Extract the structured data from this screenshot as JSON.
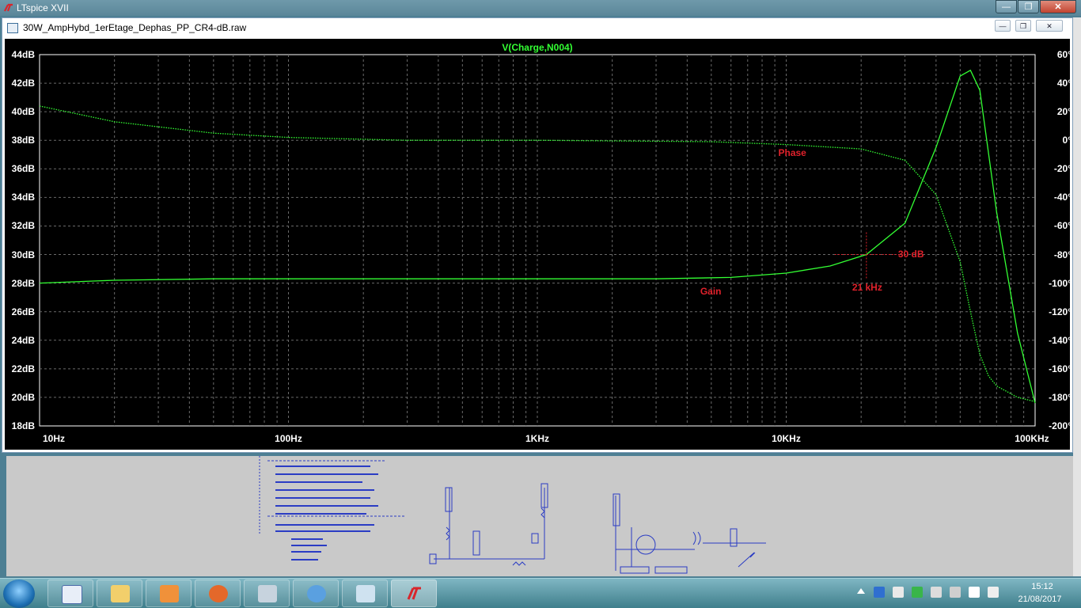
{
  "app": {
    "title": "LTspice XVII"
  },
  "child_window": {
    "title": "30W_AmpHybd_1erEtage_Dephas_PP_CR4-dB.raw"
  },
  "window_buttons": {
    "minimize": "—",
    "maximize": "❐",
    "close": "✕"
  },
  "child_buttons": {
    "minimize": "—",
    "restore": "❐",
    "close": "✕"
  },
  "colors": {
    "trace": "#33ff33",
    "annotation": "#e0212b",
    "grid": "#6a6a6a",
    "plot_bg": "#000000"
  },
  "chart_data": {
    "type": "line",
    "title": "V(Charge,N004)",
    "x_scale": "log",
    "xlim": [
      10,
      100000
    ],
    "x_tick_labels": [
      "10Hz",
      "100Hz",
      "1KHz",
      "10KHz",
      "100KHz"
    ],
    "ylim_left": [
      18,
      44
    ],
    "ylim_right": [
      -200,
      60
    ],
    "y_left_tick_labels": [
      "44dB",
      "42dB",
      "40dB",
      "38dB",
      "36dB",
      "34dB",
      "32dB",
      "30dB",
      "28dB",
      "26dB",
      "24dB",
      "22dB",
      "20dB",
      "18dB"
    ],
    "y_right_tick_labels": [
      "60°",
      "40°",
      "20°",
      "0°",
      "-20°",
      "-40°",
      "-60°",
      "-80°",
      "-100°",
      "-120°",
      "-140°",
      "-160°",
      "-180°",
      "-200°"
    ],
    "grid": true,
    "series": [
      {
        "name": "Gain",
        "axis": "left",
        "style": "solid",
        "x": [
          10,
          20,
          50,
          100,
          500,
          1000,
          3000,
          6000,
          10000,
          15000,
          21000,
          30000,
          40000,
          50000,
          55000,
          60000,
          70000,
          85000,
          100000
        ],
        "y": [
          28.0,
          28.2,
          28.3,
          28.3,
          28.3,
          28.3,
          28.3,
          28.4,
          28.7,
          29.2,
          30.0,
          32.2,
          37.5,
          42.5,
          42.9,
          41.5,
          33.0,
          24.5,
          19.6
        ]
      },
      {
        "name": "Phase",
        "axis": "right",
        "style": "dotted",
        "x": [
          10,
          20,
          50,
          100,
          300,
          1000,
          5000,
          10000,
          20000,
          30000,
          40000,
          50000,
          55000,
          60000,
          65000,
          70000,
          85000,
          100000
        ],
        "y": [
          24,
          13,
          5,
          2,
          0,
          0,
          -1,
          -3,
          -6,
          -14,
          -38,
          -85,
          -120,
          -150,
          -165,
          -172,
          -180,
          -183
        ]
      }
    ],
    "annotations": [
      {
        "text": "Phase"
      },
      {
        "text": "Gain"
      },
      {
        "text": "30 dB"
      },
      {
        "text": "21 kHz"
      }
    ],
    "cursor": {
      "x": 21000,
      "y": 30.0
    }
  },
  "taskbar": {
    "items": [
      "start",
      "word-icon",
      "explorer-icon",
      "media-player-icon",
      "firefox-icon",
      "calculator-icon",
      "orb-icon",
      "notepad-icon",
      "ltspice-icon"
    ],
    "active": "ltspice-icon",
    "time": "15:12",
    "date": "21/08/2017"
  }
}
